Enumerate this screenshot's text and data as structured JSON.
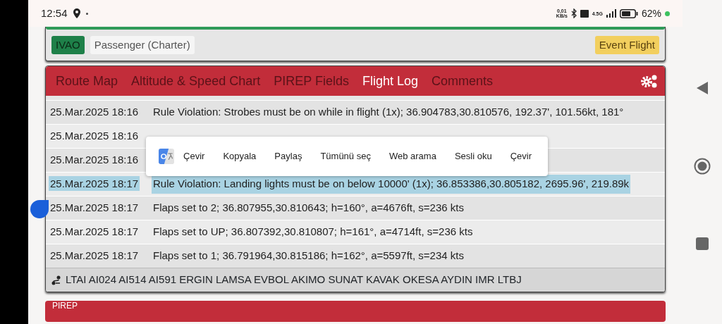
{
  "status_bar": {
    "time": "12:54",
    "net_speed": "0,01 KB/s",
    "network": "4.5G",
    "battery_percent": "62%"
  },
  "flight_card": {
    "network_badge": "IVAO",
    "flight_type": "Passenger (Charter)",
    "event_badge": "Event Flight"
  },
  "log_card": {
    "tabs": [
      {
        "label": "Route Map",
        "selected": false
      },
      {
        "label": "Altitude & Speed Chart",
        "selected": false
      },
      {
        "label": "PIREP Fields",
        "selected": false
      },
      {
        "label": "Flight Log",
        "selected": true
      },
      {
        "label": "Comments",
        "selected": false
      }
    ],
    "rows": [
      {
        "time": "25.Mar.2025 18:16",
        "message": "Rule Violation: Strobes must be on while in flight (1x); 36.904783,30.810576, 192.37', 101.56kt, 181°",
        "selected": false
      },
      {
        "time": "25.Mar.2025 18:16",
        "selected": false
      },
      {
        "time": "25.Mar.2025 18:16",
        "selected": false
      },
      {
        "time": "25.Mar.2025 18:17",
        "message": "Rule Violation: Landing lights must be on below 10000' (1x); 36.853386,30.805182, 2695.96', 219.89k",
        "selected": true
      },
      {
        "time": "25.Mar.2025 18:17",
        "message": "Flaps set to 2; 36.807955,30.810643; h=160°, a=4676ft, s=236 kts",
        "selected": false
      },
      {
        "time": "25.Mar.2025 18:17",
        "message": "Flaps set to UP; 36.807392,30.810807; h=161°, a=4714ft, s=236 kts",
        "selected": false
      },
      {
        "time": "25.Mar.2025 18:17",
        "message": "Flaps set to 1; 36.791964,30.815186; h=162°, a=5597ft, s=234 kts",
        "selected": false
      }
    ],
    "route": "LTAI AI024 AI514 AI591 ERGIN LAMSA EVBOL AKIMO SUNAT KAVAK OKESA AYDIN IMR LTBJ"
  },
  "next_card": {
    "title": "PIREP"
  },
  "context_menu": {
    "items": [
      "Çevir",
      "Kopyala",
      "Paylaş",
      "Tümünü seç",
      "Web arama",
      "Sesli oku",
      "Çevir"
    ]
  }
}
